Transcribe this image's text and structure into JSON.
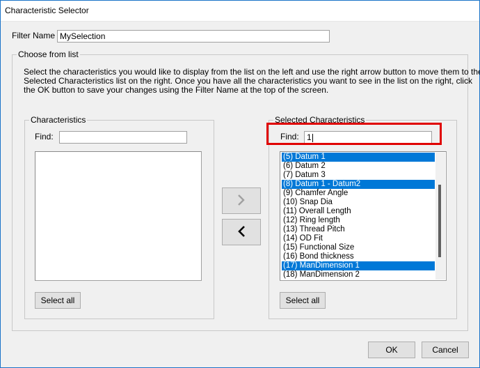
{
  "window": {
    "title": "Characteristic Selector"
  },
  "filter": {
    "label": "Filter Name",
    "value": "MySelection"
  },
  "choose_group": {
    "legend": "Choose from list",
    "instructions_line1": "Select the characteristics you would like to display from the list on the left and use the right arrow button to move them to the",
    "instructions_line2": "Selected Characteristics list on the right. Once you have all the characteristics you want to see in the list on the right, click",
    "instructions_line3": "the OK button to save your changes using the Filter Name at the top of the screen."
  },
  "left_panel": {
    "legend": "Characteristics",
    "find_label": "Find:",
    "find_value": "",
    "select_all_label": "Select all"
  },
  "right_panel": {
    "legend": "Selected Characteristics",
    "find_label": "Find:",
    "find_value": "1",
    "select_all_label": "Select all",
    "items": [
      {
        "label": "(5) Datum 1",
        "selected": true
      },
      {
        "label": "(6) Datum 2",
        "selected": false
      },
      {
        "label": "(7) Datum 3",
        "selected": false
      },
      {
        "label": "(8) Datum 1 - Datum2",
        "selected": true
      },
      {
        "label": "(9) Chamfer Angle",
        "selected": false
      },
      {
        "label": "(10) Snap Dia",
        "selected": false
      },
      {
        "label": "(11) Overall Length",
        "selected": false
      },
      {
        "label": "(12) Ring length",
        "selected": false
      },
      {
        "label": "(13) Thread Pitch",
        "selected": false
      },
      {
        "label": "(14) OD Fit",
        "selected": false
      },
      {
        "label": "(15) Functional Size",
        "selected": false
      },
      {
        "label": "(16) Bond thickness",
        "selected": false
      },
      {
        "label": "(17) ManDimension 1",
        "selected": true
      },
      {
        "label": "(18) ManDimension 2",
        "selected": false
      }
    ]
  },
  "transfer": {
    "move_right_icon": "chevron-right-icon",
    "move_left_icon": "chevron-left-icon"
  },
  "footer": {
    "ok_label": "OK",
    "cancel_label": "Cancel"
  },
  "colors": {
    "selection": "#0078d7",
    "highlight": "#e00000",
    "dialog_bg": "#f0f0f0"
  }
}
